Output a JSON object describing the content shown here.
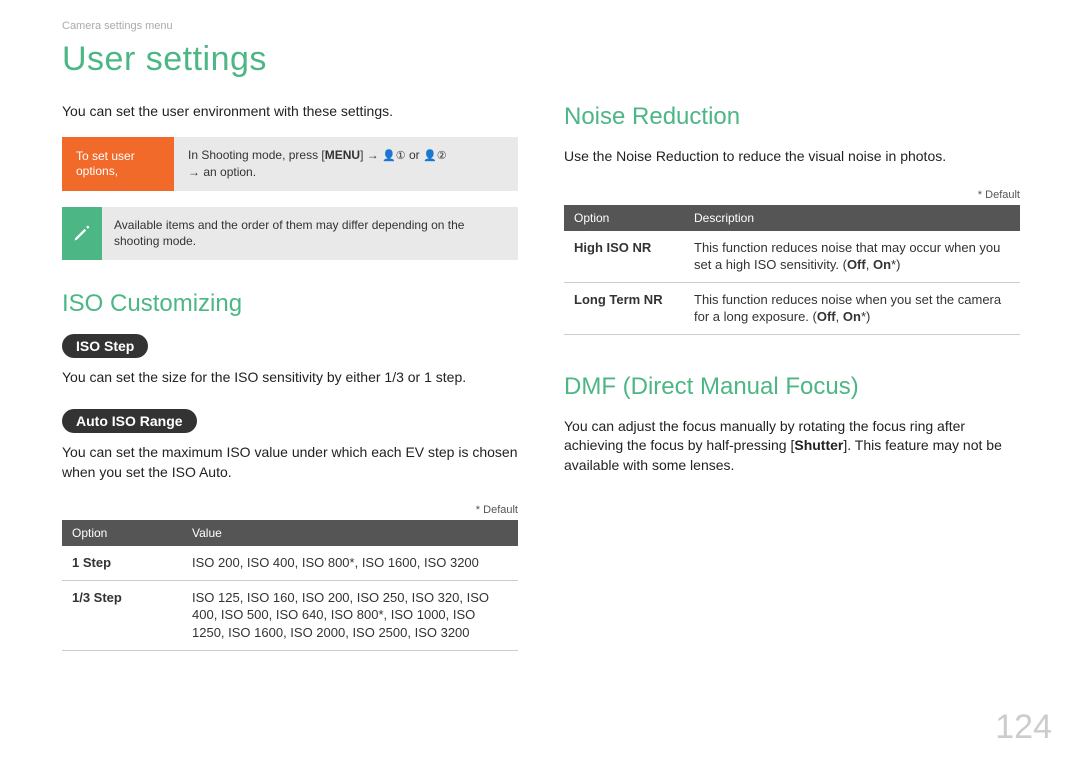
{
  "breadcrumb": "Camera settings menu",
  "page_title": "User settings",
  "page_number": "124",
  "left": {
    "intro": "You can set the user environment with these settings.",
    "callout": {
      "label": "To set user options,",
      "body_prefix": "In Shooting mode, press [",
      "menu": "MENU",
      "body_mid": "] → ",
      "icon1": "👤①",
      "or": " or ",
      "icon2": "👤②",
      "body_suffix": " → an option."
    },
    "note": "Available items and the order of them may differ depending on the shooting mode.",
    "iso_customizing": {
      "heading": "ISO Customizing",
      "iso_step": {
        "label": "ISO Step",
        "desc": "You can set the size for the ISO sensitivity by either 1/3 or 1 step."
      },
      "auto_iso": {
        "label": "Auto ISO Range",
        "desc": "You can set the maximum ISO value under which each EV step is chosen when you set the ISO Auto.",
        "default_note": "* Default",
        "headers": {
          "c1": "Option",
          "c2": "Value"
        },
        "rows": [
          {
            "option": "1 Step",
            "value": "ISO 200, ISO 400, ISO 800*, ISO 1600, ISO 3200"
          },
          {
            "option": "1/3 Step",
            "value": "ISO 125, ISO 160, ISO 200, ISO 250, ISO 320, ISO 400, ISO 500, ISO 640, ISO 800*, ISO 1000, ISO 1250, ISO 1600, ISO 2000, ISO 2500, ISO 3200"
          }
        ]
      }
    }
  },
  "right": {
    "noise_reduction": {
      "heading": "Noise Reduction",
      "desc": "Use the Noise Reduction to reduce the visual noise in photos.",
      "default_note": "* Default",
      "headers": {
        "c1": "Option",
        "c2": "Description"
      },
      "rows": [
        {
          "option": "High ISO NR",
          "desc_pre": "This function reduces noise that may occur when you set a high ISO sensitivity. (",
          "off": "Off",
          "sep": ", ",
          "on": "On",
          "star": "*",
          "close": ")"
        },
        {
          "option": "Long Term NR",
          "desc_pre": "This function reduces noise when you set the camera for a long exposure. (",
          "off": "Off",
          "sep": ", ",
          "on": "On",
          "star": "*",
          "close": ")"
        }
      ]
    },
    "dmf": {
      "heading": "DMF (Direct Manual Focus)",
      "desc_pre": "You can adjust the focus manually by rotating the focus ring after achieving the focus by half-pressing [",
      "shutter": "Shutter",
      "desc_post": "]. This feature may not be available with some lenses."
    }
  }
}
